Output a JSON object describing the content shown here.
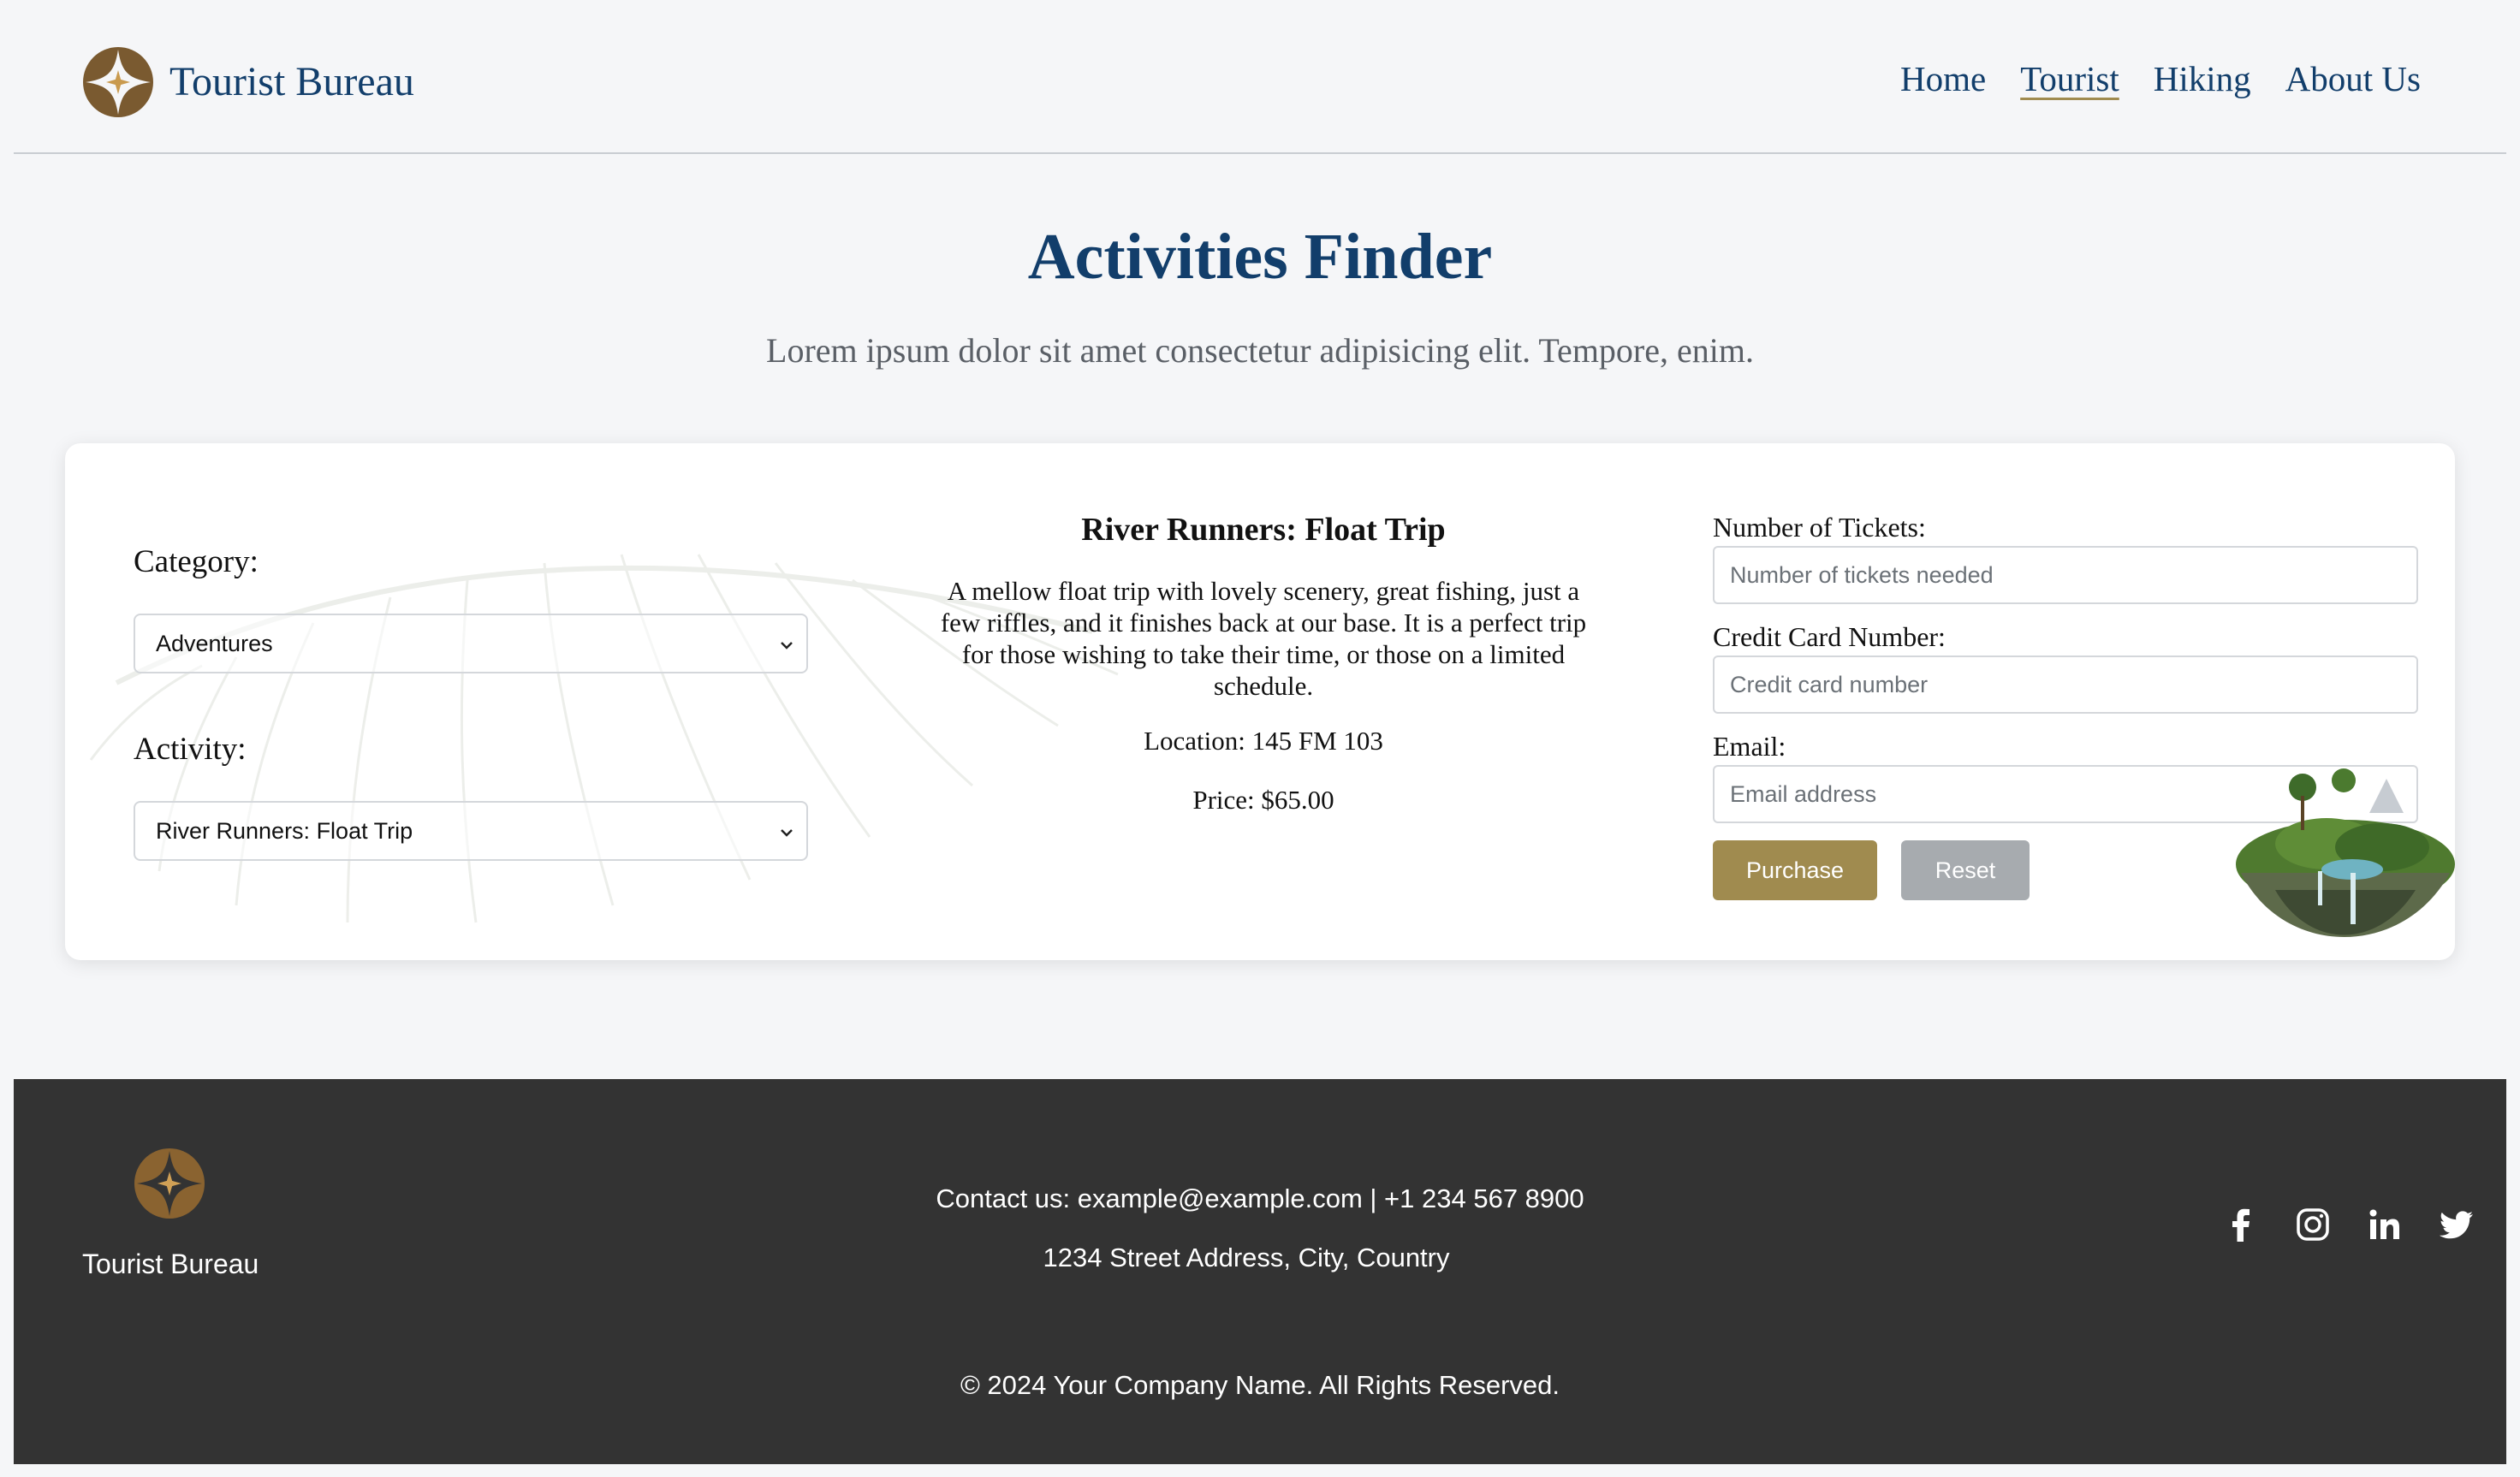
{
  "header": {
    "brand_name": "Tourist Bureau",
    "nav": [
      "Home",
      "Tourist",
      "Hiking",
      "About Us"
    ],
    "active_nav": "Tourist"
  },
  "hero": {
    "title": "Activities Finder",
    "subtitle": "Lorem ipsum dolor sit amet consectetur adipisicing elit. Tempore, enim."
  },
  "filters": {
    "category_label": "Category:",
    "category_value": "Adventures",
    "activity_label": "Activity:",
    "activity_value": "River Runners: Float Trip"
  },
  "activity": {
    "title": "River Runners: Float Trip",
    "description": "A mellow float trip with lovely scenery, great fishing, just a few riffles, and it finishes back at our base. It is a perfect trip for those wishing to take their time, or those on a limited schedule.",
    "location": "Location: 145 FM 103",
    "price": "Price: $65.00"
  },
  "purchase_form": {
    "tickets_label": "Number of Tickets:",
    "tickets_placeholder": "Number of tickets needed",
    "card_label": "Credit Card Number:",
    "card_placeholder": "Credit card number",
    "email_label": "Email:",
    "email_placeholder": "Email address",
    "purchase_button": "Purchase",
    "reset_button": "Reset"
  },
  "footer": {
    "brand_name": "Tourist Bureau",
    "contact": "Contact us: example@example.com | +1 234 567 8900",
    "address": "1234 Street Address, City, Country",
    "copyright": "© 2024 Your Company Name. All Rights Reserved.",
    "social_icons": [
      "facebook-icon",
      "instagram-icon",
      "linkedin-icon",
      "twitter-icon"
    ]
  },
  "colors": {
    "primary_navy": "#123e6b",
    "accent_gold": "#a08b4f",
    "reset_gray": "#a7abaf",
    "footer_bg": "#333333",
    "page_bg": "#f5f6f8"
  }
}
